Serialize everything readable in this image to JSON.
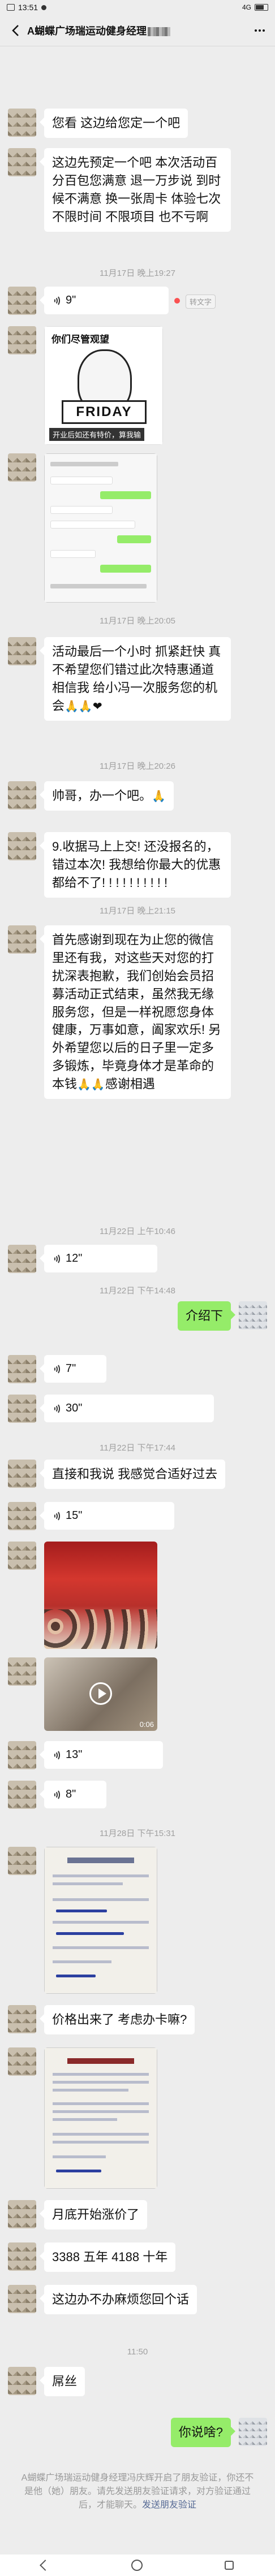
{
  "status_bar": {
    "time": "13:51",
    "signal": "4G",
    "battery": ""
  },
  "header": {
    "title": "A蝴蝶广场瑞运动健身经理"
  },
  "messages": {
    "m1": "您看   这边给您定一个吧",
    "m2": "这边先预定一个吧 本次活动百分百包您满意 退一万步说 到时候不满意 换一张周卡 体验七次 不限时间 不限项目 也不亏啊",
    "t1": "11月17日 晚上19:27",
    "v1": "9\"",
    "to_text_label": "转文字",
    "meme_caption": "你们尽管观望",
    "meme_sign": "FRIDAY",
    "meme_sub": "开业后如还有特价，算我输",
    "t2": "11月17日 晚上20:05",
    "m3a": "活动最后一个小时  抓紧赶快 真不希望您们错过此次特惠通道",
    "m3b": "相信我 给小冯一次服务您的机会",
    "m3_emoji": "🙏🙏❤",
    "t3": "11月17日 晚上20:26",
    "m4": "帅哥，办一个吧。",
    "m4_emoji": "🙏",
    "m5": "9.收据马上上交! 还没报名的，错过本次! 我想给你最大的优惠都给不了! ! ! ! ! ! ! ! ! !",
    "t4": "11月17日 晚上21:15",
    "m6a": "首先感谢到现在为止您的微信里还有我，对这些天对您的打扰深表抱歉，我们创始会员招募活动正式结束，虽然我无缘服务您，但是一样祝愿您身体健康，万事如意，阖家欢乐! 另外希望您以后的日子里一定多多锻炼，毕竟身体才是革命的本钱",
    "m6_emoji": "🙏🙏",
    "m6b": "感谢相遇",
    "t5": "11月22日 上午10:46",
    "v2": "12\"",
    "t6": "11月22日 下午14:48",
    "me1": "介绍下",
    "v3": "7\"",
    "v4": "30\"",
    "t7": "11月22日 下午17:44",
    "m7": "直接和我说 我感觉合适好过去",
    "v5": "15\"",
    "video_duration": "0:06",
    "v6": "13\"",
    "v7": "8\"",
    "t8": "11月28日 下午15:31",
    "m8": "价格出来了 考虑办卡嘛?",
    "m9": "月底开始涨价了",
    "m10": "3388 五年  4188 十年",
    "m11": "这边办不办麻烦您回个话",
    "t9": "11:50",
    "m12": "屌丝",
    "me2": "你说啥?"
  },
  "footer": {
    "notice": "A蝴蝶广场瑞运动健身经理冯庆辉开启了朋友验证，你还不是他（她）朋友。请先发送朋友验证请求，对方验证通过后，才能聊天。",
    "link": "发送朋友验证"
  }
}
